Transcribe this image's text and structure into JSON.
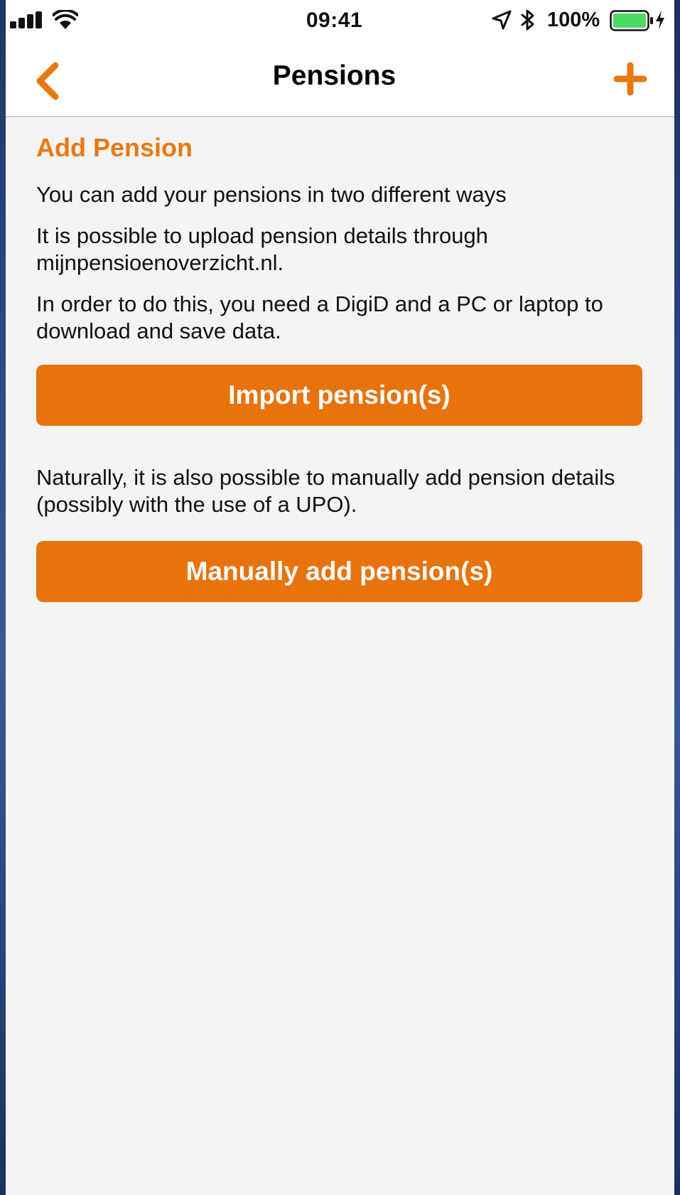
{
  "status_bar": {
    "time": "09:41",
    "battery_percent": "100%",
    "battery_level": 1.0,
    "icons": [
      "signal-icon",
      "wifi-icon",
      "location-icon",
      "bluetooth-icon",
      "battery-icon",
      "charging-icon"
    ]
  },
  "nav": {
    "title": "Pensions",
    "back_icon": "chevron-left-icon",
    "add_icon": "plus-icon"
  },
  "content": {
    "section_title": "Add Pension",
    "intro": "You can add your pensions in two different ways",
    "upload_text": "It is possible to upload pension details through mijnpensioenoverzicht.nl.",
    "requirement_text": "In order to do this, you need a DigiD and a PC or laptop to download and save data.",
    "import_button": "Import pension(s)",
    "manual_text": "Naturally, it is also possible to manually add pension details (possibly with the use of a UPO).",
    "manual_button": "Manually add pension(s)"
  },
  "colors": {
    "accent": "#e8790f",
    "button": "#e8720b",
    "background": "#f4f4f4",
    "battery_green": "#4cd964"
  }
}
